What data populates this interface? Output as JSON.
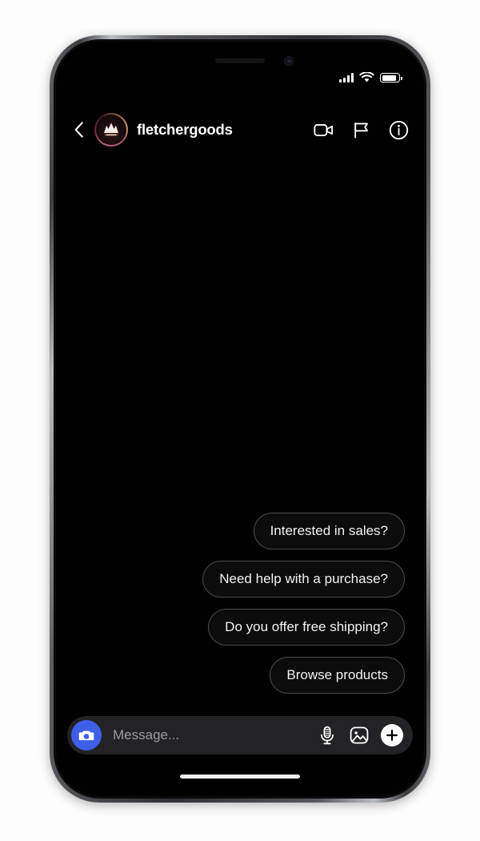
{
  "device": {
    "notch_speaker": "speaker-grille",
    "notch_camera": "front-camera",
    "home_indicator": "home-indicator",
    "buttons": [
      "silent-switch",
      "volume-up",
      "volume-down",
      "power"
    ]
  },
  "status_bar": {
    "signal_icon": "cellular-signal-icon",
    "signal_bars": 4,
    "wifi_icon": "wifi-icon",
    "battery_icon": "battery-icon",
    "battery_level": 88
  },
  "header": {
    "back_icon": "chevron-left-icon",
    "avatar": {
      "name": "avatar",
      "alt": "fletchergoods profile picture",
      "ring_colors": [
        "#c2667f",
        "#7c2b45",
        "#3d1622",
        "#c79a6b"
      ]
    },
    "username": "fletchergoods",
    "actions": [
      {
        "name": "video-call-icon",
        "label": "Video call"
      },
      {
        "name": "flag-icon",
        "label": "Report"
      },
      {
        "name": "info-icon",
        "label": "Details"
      }
    ]
  },
  "conversation": {
    "quick_replies": [
      {
        "text": "Interested in sales?"
      },
      {
        "text": "Need help with a purchase?"
      },
      {
        "text": "Do you offer free shipping?"
      },
      {
        "text": "Browse products"
      }
    ]
  },
  "composer": {
    "camera_icon": "camera-icon",
    "input_value": "",
    "input_placeholder": "Message...",
    "mic_icon": "microphone-icon",
    "gallery_icon": "image-icon",
    "plus_icon": "plus-icon"
  },
  "colors": {
    "accent_blue": "#3f5fe8",
    "screen_bg": "#000000",
    "bubble_bg": "#0c0c0d",
    "bubble_border": "#4a4a4d",
    "input_bar_bg": "#232325",
    "placeholder": "#9b9b9e"
  }
}
